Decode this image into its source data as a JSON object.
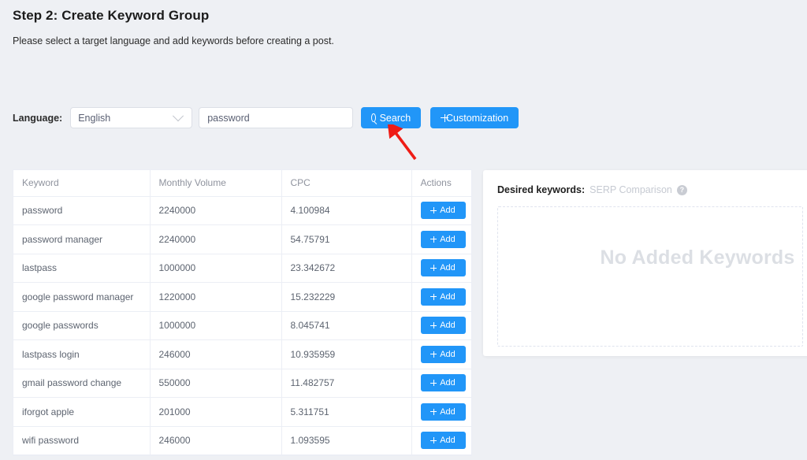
{
  "header": {
    "title": "Step 2: Create Keyword Group",
    "subtitle": "Please select a target language and add keywords before creating a post."
  },
  "controls": {
    "language_label": "Language:",
    "language_value": "English",
    "language_options": [
      "English"
    ],
    "search_input_value": "password",
    "search_input_placeholder": "password",
    "search_button_label": "Search",
    "customization_button_label": "Customization",
    "search_icon": "search-icon",
    "plus_icon": "plus-icon",
    "chevron_icon": "chevron-down-icon"
  },
  "annotation": {
    "arrow_color": "#ee1c16",
    "arrow_points_to": "Search"
  },
  "table": {
    "columns": [
      "Keyword",
      "Monthly Volume",
      "CPC",
      "Actions"
    ],
    "add_label": "Add",
    "rows": [
      {
        "keyword": "password",
        "volume": "2240000",
        "cpc": "4.100984"
      },
      {
        "keyword": "password manager",
        "volume": "2240000",
        "cpc": "54.75791"
      },
      {
        "keyword": "lastpass",
        "volume": "1000000",
        "cpc": "23.342672"
      },
      {
        "keyword": "google password manager",
        "volume": "1220000",
        "cpc": "15.232229"
      },
      {
        "keyword": "google passwords",
        "volume": "1000000",
        "cpc": "8.045741"
      },
      {
        "keyword": "lastpass login",
        "volume": "246000",
        "cpc": "10.935959"
      },
      {
        "keyword": "gmail password change",
        "volume": "550000",
        "cpc": "11.482757"
      },
      {
        "keyword": "iforgot apple",
        "volume": "201000",
        "cpc": "5.311751"
      },
      {
        "keyword": "wifi password",
        "volume": "246000",
        "cpc": "1.093595"
      }
    ]
  },
  "right_panel": {
    "desired_keywords_label": "Desired keywords:",
    "serp_comparison_label": "SERP Comparison",
    "help_icon_glyph": "?",
    "empty_state_text": "No Added Keywords"
  },
  "colors": {
    "accent": "#2196f8",
    "page_background": "#eef0f4",
    "annotation_red": "#ee1c16",
    "muted_text": "#8f939e"
  }
}
